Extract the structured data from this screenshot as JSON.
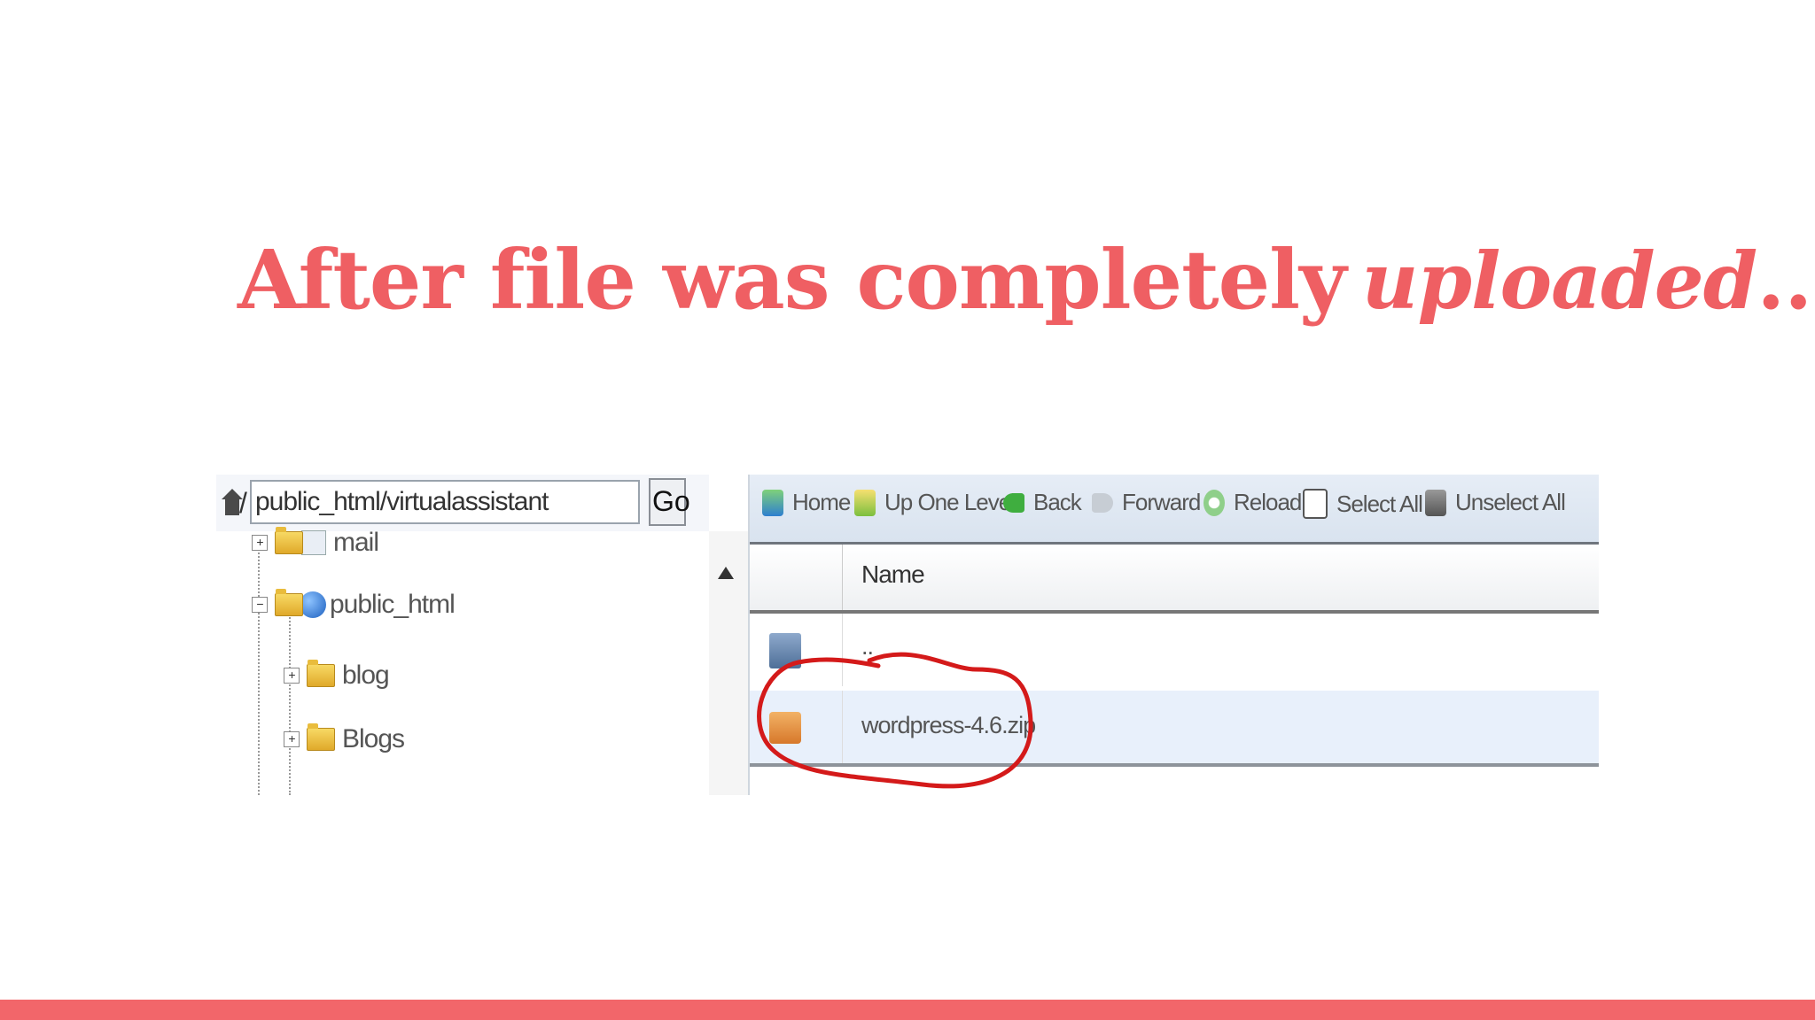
{
  "slide": {
    "title_main": "After file was completely",
    "title_em": "uploaded",
    "title_end": ".."
  },
  "colors": {
    "accent": "#ef5f63",
    "bar": "#f2666a"
  },
  "file_manager": {
    "path_value": "public_html/virtualassistant",
    "go_label": "Go",
    "tree": [
      {
        "label": "mail",
        "expander": "+"
      },
      {
        "label": "public_html",
        "expander": "−"
      },
      {
        "label": "blog",
        "expander": "+"
      },
      {
        "label": "Blogs",
        "expander": "+"
      }
    ],
    "toolbar": [
      "Home",
      "Up One Level",
      "Back",
      "Forward",
      "Reload",
      "Select All",
      "Unselect All"
    ],
    "columns": {
      "name": "Name"
    },
    "files": [
      {
        "name": "..",
        "icon": "folder-icon"
      },
      {
        "name": "wordpress-4.6.zip",
        "icon": "zip-icon"
      }
    ]
  }
}
